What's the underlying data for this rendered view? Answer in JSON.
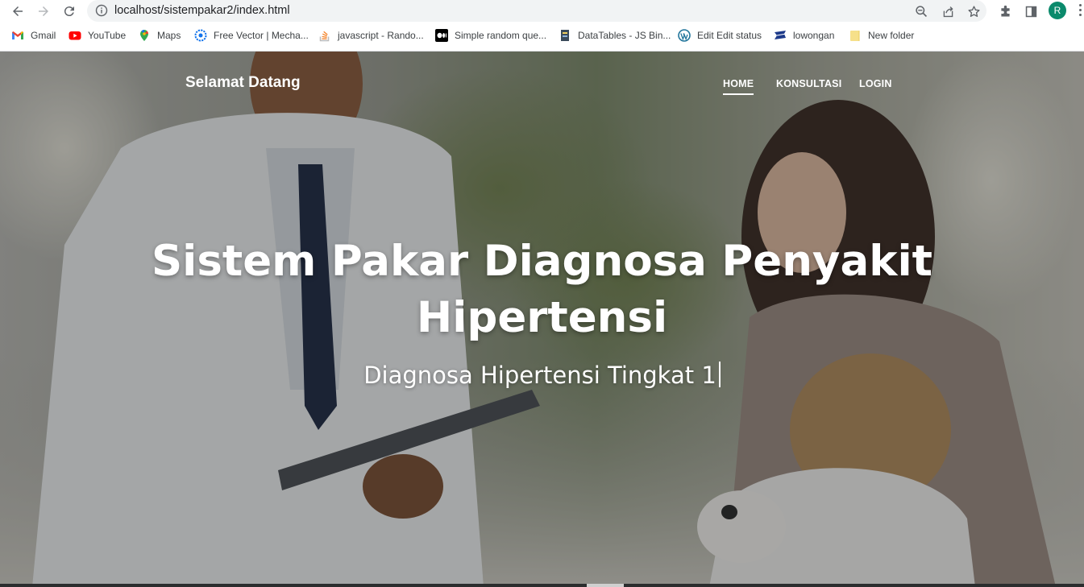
{
  "browser": {
    "url": "localhost/sistempakar2/index.html",
    "profile_initial": "R",
    "accent": "#0b8a6c",
    "bookmarks": [
      {
        "label": "Gmail",
        "icon": "gmail-icon"
      },
      {
        "label": "YouTube",
        "icon": "youtube-icon"
      },
      {
        "label": "Maps",
        "icon": "maps-icon"
      },
      {
        "label": "Free Vector | Mecha...",
        "icon": "freepik-icon"
      },
      {
        "label": "javascript - Rando...",
        "icon": "stackoverflow-icon"
      },
      {
        "label": "Simple random que...",
        "icon": "medium-icon"
      },
      {
        "label": "DataTables - JS Bin...",
        "icon": "jsbin-icon"
      },
      {
        "label": "Edit Edit status",
        "icon": "wordpress-icon"
      },
      {
        "label": "lowongan",
        "icon": "flag-icon"
      },
      {
        "label": "New folder",
        "icon": "folder-icon"
      }
    ]
  },
  "navbar": {
    "brand": "Selamat Datang",
    "items": [
      {
        "label": "HOME",
        "active": true
      },
      {
        "label": "KONSULTASI",
        "active": false
      },
      {
        "label": "LOGIN",
        "active": false
      }
    ]
  },
  "hero": {
    "title_line1": "Sistem Pakar Diagnosa Penyakit",
    "title_line2": "Hipertensi",
    "subtitle": "Diagnosa Hipertensi Tingkat 1"
  }
}
